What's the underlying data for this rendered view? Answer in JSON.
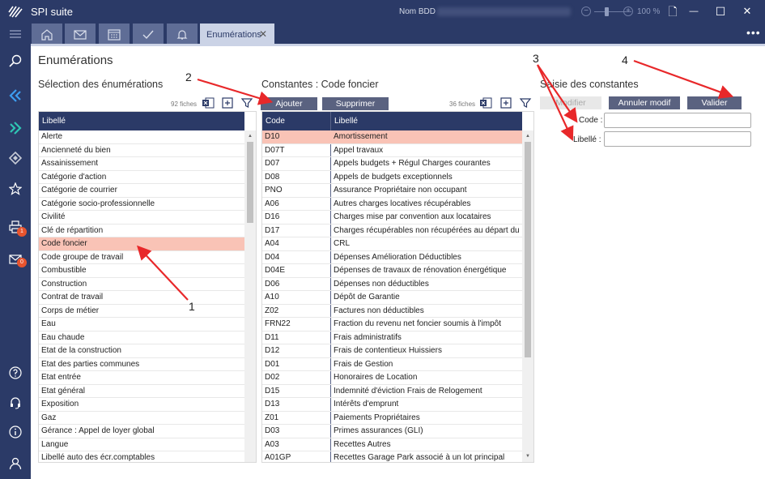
{
  "app": {
    "title": "SPI suite",
    "db_label": "Nom BDD",
    "zoom": {
      "minus": "−",
      "plus": "+",
      "value": "100 %"
    }
  },
  "window_buttons": {
    "document": "🗋",
    "minimize": "—",
    "maximize": "☐",
    "close": "✕"
  },
  "tabs": {
    "icons": [
      "home-icon",
      "mail-icon",
      "calendar-icon",
      "check-icon",
      "bell-icon"
    ],
    "active_label": "Enumérations",
    "close_glyph": "✕",
    "more": "•••"
  },
  "left_nav": {
    "items": [
      "search-icon",
      "module-blue-icon",
      "module-teal-icon",
      "module-grey-icon",
      "star-icon",
      "print-icon",
      "mail-icon",
      "help-icon",
      "headset-icon",
      "info-icon",
      "user-icon"
    ],
    "print_badge": "1",
    "mail_badge": "0"
  },
  "page": {
    "title": "Enumérations"
  },
  "left_panel": {
    "title": "Sélection des énumérations",
    "count": "92 fiches",
    "header": "Libellé",
    "selected_index": 8,
    "items": [
      "Alerte",
      "Ancienneté du bien",
      "Assainissement",
      "Catégorie d'action",
      "Catégorie de courrier",
      "Catégorie socio-professionnelle",
      "Civilité",
      "Clé de répartition",
      "Code foncier",
      "Code groupe de travail",
      "Combustible",
      "Construction",
      "Contrat de travail",
      "Corps de métier",
      "Eau",
      "Eau chaude",
      "Etat de la construction",
      "Etat des parties communes",
      "Etat entrée",
      "Etat général",
      "Exposition",
      "Gaz",
      "Gérance : Appel de loyer global",
      "Langue",
      "Libellé auto des écr.comptables"
    ]
  },
  "middle_panel": {
    "title": "Constantes : Code foncier",
    "count": "36 fiches",
    "add_label": "Ajouter",
    "delete_label": "Supprimer",
    "headers": {
      "code": "Code",
      "label": "Libellé"
    },
    "selected_index": 0,
    "rows": [
      {
        "code": "D10",
        "label": "Amortissement"
      },
      {
        "code": "D07T",
        "label": "Appel travaux"
      },
      {
        "code": "D07",
        "label": "Appels budgets + Régul Charges courantes"
      },
      {
        "code": "D08",
        "label": "Appels de budgets exceptionnels"
      },
      {
        "code": "PNO",
        "label": "Assurance Propriétaire non occupant"
      },
      {
        "code": "A06",
        "label": "Autres charges locatives récupérables"
      },
      {
        "code": "D16",
        "label": "Charges mise par convention aux locataires"
      },
      {
        "code": "D17",
        "label": "Charges récupérables non récupérées au départ du l..."
      },
      {
        "code": "A04",
        "label": "CRL"
      },
      {
        "code": "D04",
        "label": "Dépenses Amélioration Déductibles"
      },
      {
        "code": "D04E",
        "label": "Dépenses de travaux de rénovation énergétique"
      },
      {
        "code": "D06",
        "label": "Dépenses non déductibles"
      },
      {
        "code": "A10",
        "label": "Dépôt de Garantie"
      },
      {
        "code": "Z02",
        "label": "Factures non déductibles"
      },
      {
        "code": "FRN22",
        "label": "Fraction du revenu net foncier soumis à l'impôt"
      },
      {
        "code": "D11",
        "label": "Frais administratifs"
      },
      {
        "code": "D12",
        "label": "Frais de contentieux Huissiers"
      },
      {
        "code": "D01",
        "label": "Frais de Gestion"
      },
      {
        "code": "D02",
        "label": "Honoraires de Location"
      },
      {
        "code": "D15",
        "label": "Indemnité d'éviction Frais de Relogement"
      },
      {
        "code": "D13",
        "label": "Intérêts d'emprunt"
      },
      {
        "code": "Z01",
        "label": "Paiements Propriétaires"
      },
      {
        "code": "D03",
        "label": "Primes assurances (GLI)"
      },
      {
        "code": "A03",
        "label": "Recettes Autres"
      },
      {
        "code": "A01GP",
        "label": "Recettes Garage Park associé à un lot principal"
      }
    ]
  },
  "right_panel": {
    "title": "Saisie des constantes",
    "modify_label": "Modifier",
    "cancel_label": "Annuler modif",
    "validate_label": "Valider",
    "code_label": "Code :",
    "libelle_label": "Libellé :",
    "code_value": "",
    "libelle_value": ""
  },
  "annotations": [
    "1",
    "2",
    "3",
    "4"
  ],
  "colors": {
    "navy": "#2b3a67",
    "selected_row": "#f9c3b6",
    "button": "#5a6280",
    "arrow": "#e8282a"
  }
}
